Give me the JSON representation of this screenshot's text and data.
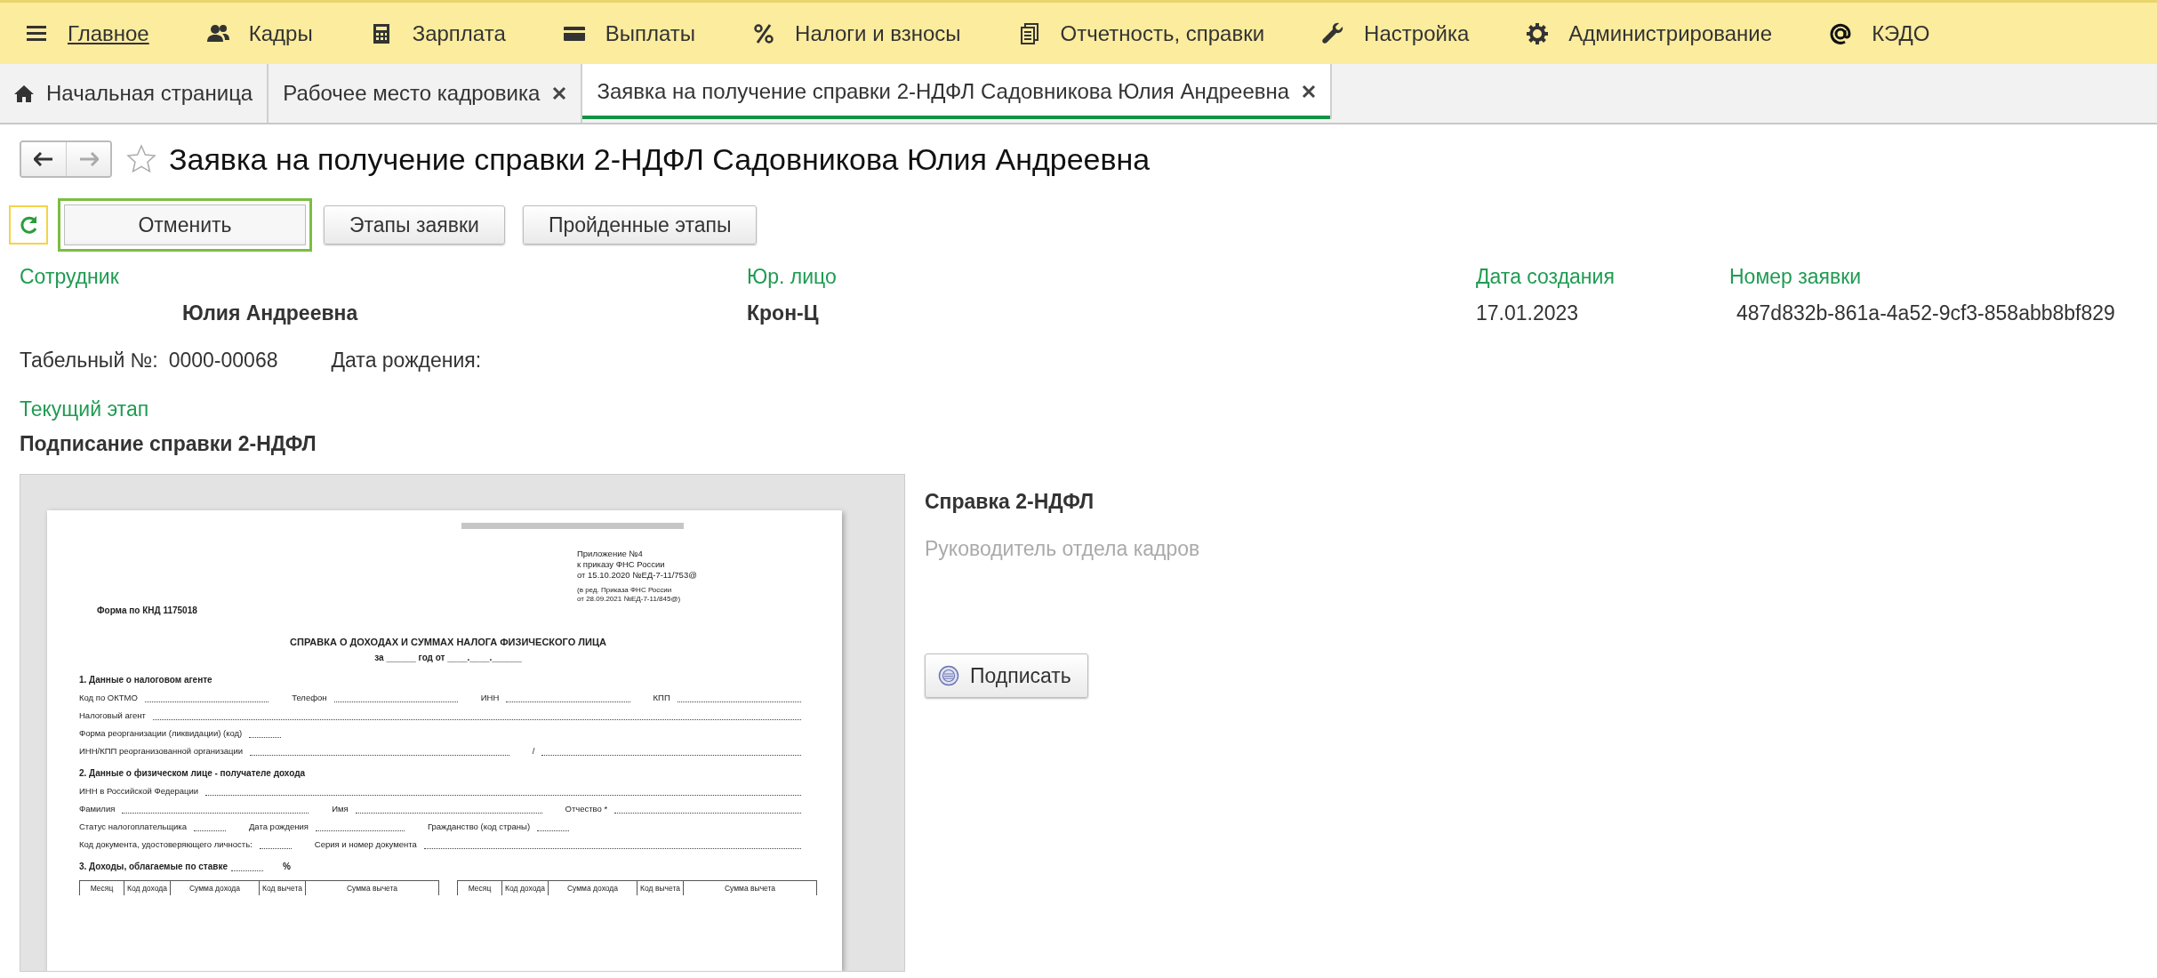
{
  "menu": [
    {
      "kind": "hamburger",
      "label": "Главное",
      "selected": true
    },
    {
      "kind": "people",
      "label": "Кадры",
      "selected": false
    },
    {
      "kind": "calculator",
      "label": "Зарплата",
      "selected": false
    },
    {
      "kind": "wallet",
      "label": "Выплаты",
      "selected": false
    },
    {
      "kind": "percent",
      "label": "Налоги и взносы",
      "selected": false
    },
    {
      "kind": "documents",
      "label": "Отчетность, справки",
      "selected": false
    },
    {
      "kind": "wrench",
      "label": "Настройка",
      "selected": false
    },
    {
      "kind": "gear",
      "label": "Администрирование",
      "selected": false
    },
    {
      "kind": "at",
      "label": "КЭДО",
      "selected": false
    }
  ],
  "tabs": [
    {
      "kind": "home",
      "label": "Начальная страница",
      "selected": false
    },
    {
      "kind": "page",
      "label": "Рабочее место кадровика",
      "selected": false
    },
    {
      "kind": "page",
      "label": "Заявка на получение справки 2-НДФЛ Садовникова Юлия Андреевна",
      "selected": true
    }
  ],
  "form": {
    "title": "Заявка на получение справки 2-НДФЛ Садовникова Юлия Андреевна",
    "back_disabled": false,
    "forward_disabled": true,
    "favorite": false,
    "refresh": {
      "highlighted": true
    },
    "buttons": [
      {
        "label": "Отменить",
        "focused": true
      },
      {
        "label": "Этапы заявки",
        "focused": false
      },
      {
        "label": "Пройденные этапы",
        "focused": false
      }
    ],
    "fields": [
      {
        "label": "Сотрудник",
        "value": "Юлия Андреевна"
      },
      {
        "label": "Юр. лицо",
        "value": "Крон-Ц"
      },
      {
        "label": "Дата создания",
        "value": "17.01.2023"
      },
      {
        "label": "Номер заявки",
        "value": "487d832b-861a-4a52-9cf3-858abb8bf829"
      }
    ],
    "details": [
      {
        "label": "Табельный №:",
        "value": "0000-00068"
      },
      {
        "label": "Дата рождения:"
      }
    ],
    "stage": {
      "label": "Текущий этап",
      "value": "Подписание справки 2-НДФЛ"
    },
    "document": {
      "appendix": [
        "Приложение №4",
        "к приказу ФНС России",
        "от 15.10.2020 №ЕД-7-11/753@"
      ],
      "amendment": [
        "(в ред. Приказа ФНС России",
        "от 28.09.2021 №ЕД-7-11/845@)"
      ],
      "knd": "Форма по КНД 1175018",
      "heading": "СПРАВКА О ДОХОДАХ И СУММАХ НАЛОГА ФИЗИЧЕСКОГО ЛИЦА",
      "period": "за ______ год   от ____.____.______",
      "sections": [
        {
          "title": "1. Данные о налоговом агенте",
          "rows": [
            {
              "fields": [
                {
                  "label": "Код по ОКТМО",
                  "kind": "long"
                },
                {
                  "label": "Телефон",
                  "kind": "long"
                },
                {
                  "label": "ИНН",
                  "kind": "long"
                },
                {
                  "label": "КПП",
                  "kind": "long"
                }
              ]
            },
            {
              "fields": [
                {
                  "label": "Налоговый агент",
                  "kind": "long"
                }
              ]
            },
            {
              "fields": [
                {
                  "label": "Форма реорганизации (ликвидации) (код)",
                  "kind": "short"
                }
              ]
            },
            {
              "fields": [
                {
                  "label": "ИНН/КПП реорганизованной организации",
                  "kind": "long"
                },
                {
                  "label": "/",
                  "kind": "long"
                }
              ]
            }
          ]
        },
        {
          "title": "2. Данные о физическом лице - получателе дохода",
          "rows": [
            {
              "fields": [
                {
                  "label": "ИНН в Российской Федерации",
                  "kind": "long"
                }
              ]
            },
            {
              "fields": [
                {
                  "label": "Фамилия",
                  "kind": "long"
                },
                {
                  "label": "Имя",
                  "kind": "long"
                },
                {
                  "label": "Отчество *",
                  "kind": "long"
                }
              ]
            },
            {
              "fields": [
                {
                  "label": "Статус налогоплательщика",
                  "kind": "short"
                },
                {
                  "label": "Дата рождения",
                  "kind": "date"
                },
                {
                  "label": "Гражданство (код страны)",
                  "kind": "short"
                }
              ]
            },
            {
              "fields": [
                {
                  "label": "Код документа, удостоверяющего личность:",
                  "kind": "short"
                },
                {
                  "label": "Серия и номер документа",
                  "kind": "long"
                }
              ]
            }
          ]
        },
        {
          "title": "3. Доходы, облагаемые по ставке",
          "suffix": "%"
        }
      ],
      "table_columns": [
        "Месяц",
        "Код дохода",
        "Сумма дохода",
        "Код вычета",
        "Сумма вычета",
        "Месяц",
        "Код дохода",
        "Сумма дохода",
        "Код вычета",
        "Сумма вычета"
      ]
    },
    "side": {
      "title": "Справка 2-НДФЛ",
      "signer": "Руководитель отдела кадров",
      "sign_button": "Подписать"
    }
  }
}
